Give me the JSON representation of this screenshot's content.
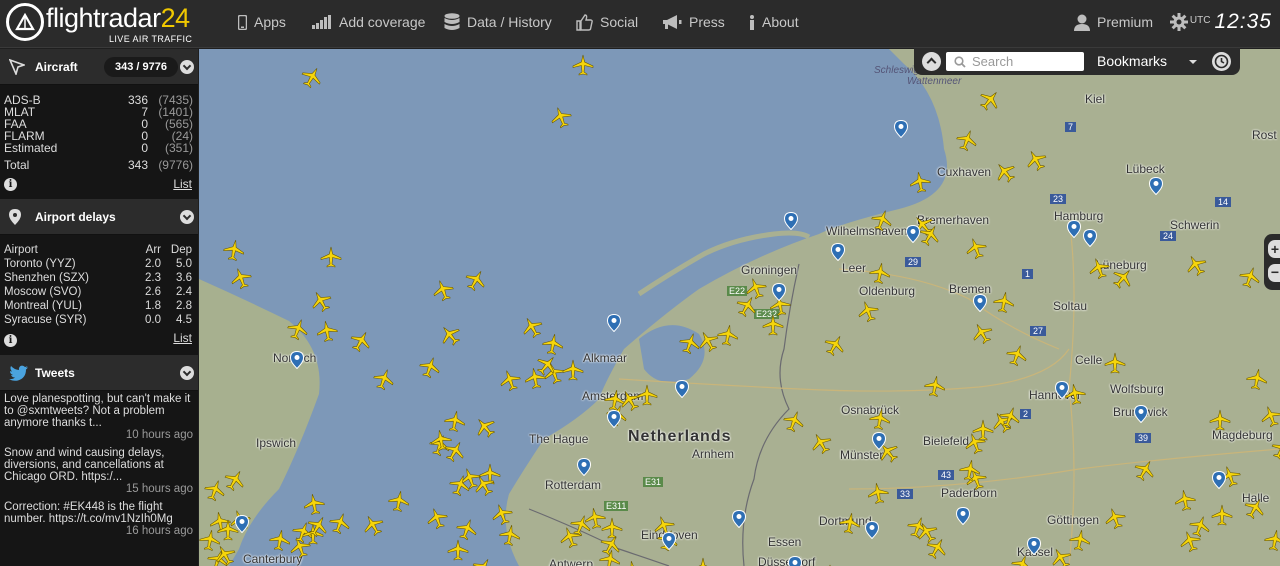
{
  "app": {
    "logo_name": "flightradar",
    "logo_num": "24",
    "logo_tagline": "LIVE AIR TRAFFIC"
  },
  "nav": [
    {
      "label": "Apps",
      "icon": "phone-icon"
    },
    {
      "label": "Add coverage",
      "icon": "signal-bars-icon"
    },
    {
      "label": "Data / History",
      "icon": "database-icon"
    },
    {
      "label": "Social",
      "icon": "thumbs-up-icon"
    },
    {
      "label": "Press",
      "icon": "megaphone-icon"
    },
    {
      "label": "About",
      "icon": "info-icon"
    },
    {
      "label": "Premium",
      "icon": "user-icon"
    }
  ],
  "clock": {
    "zone": "UTC",
    "time": "12:35"
  },
  "search": {
    "placeholder": "Search",
    "bookmarks": "Bookmarks"
  },
  "aircraft": {
    "title": "Aircraft",
    "count": "343 / 9776",
    "rows": [
      {
        "label": "ADS-B",
        "value": "336",
        "total": "(7435)"
      },
      {
        "label": "MLAT",
        "value": "7",
        "total": "(1401)"
      },
      {
        "label": "FAA",
        "value": "0",
        "total": "(565)"
      },
      {
        "label": "FLARM",
        "value": "0",
        "total": "(24)"
      },
      {
        "label": "Estimated",
        "value": "0",
        "total": "(351)"
      }
    ],
    "total": {
      "label": "Total",
      "value": "343",
      "total": "(9776)"
    },
    "list": "List"
  },
  "delays": {
    "title": "Airport delays",
    "headers": {
      "airport": "Airport",
      "arr": "Arr",
      "dep": "Dep"
    },
    "rows": [
      {
        "airport": "Toronto (YYZ)",
        "arr": "2.0",
        "dep": "5.0"
      },
      {
        "airport": "Shenzhen (SZX)",
        "arr": "2.3",
        "dep": "3.6"
      },
      {
        "airport": "Moscow (SVO)",
        "arr": "2.6",
        "dep": "2.4"
      },
      {
        "airport": "Montreal (YUL)",
        "arr": "1.8",
        "dep": "2.8"
      },
      {
        "airport": "Syracuse (SYR)",
        "arr": "0.0",
        "dep": "4.5"
      }
    ],
    "list": "List"
  },
  "tweets": {
    "title": "Tweets",
    "items": [
      {
        "text": "Love planespotting, but can't make it to @sxmtweets? Not a problem anymore thanks t...",
        "when": "10 hours ago"
      },
      {
        "text": "Snow and wind causing delays, diversions, and cancellations at Chicago ORD. https:/...",
        "when": "15 hours ago"
      },
      {
        "text": "Correction: #EK448 is the flight number. https://t.co/mv1NzIh0Mg",
        "when": "16 hours ago"
      }
    ]
  },
  "map_labels": {
    "netherlands": "Netherlands",
    "norwich": "Norwich",
    "ipswich": "Ipswich",
    "canterbury": "Canterbury",
    "alkmaar": "Alkmaar",
    "amsterdam": "Amsterdam",
    "the_hague": "The Hague",
    "rotterdam": "Rotterdam",
    "arnhem": "Arnhem",
    "eindhoven": "Eindhoven",
    "antwerp": "Antwerp",
    "groningen": "Groningen",
    "leer": "Leer",
    "oldenburg": "Oldenburg",
    "wilhelmshaven": "Wilhelmshaven",
    "bremerhaven": "Bremerhaven",
    "cuxhaven": "Cuxhaven",
    "bremen": "Bremen",
    "hamburg": "Hamburg",
    "kiel": "Kiel",
    "lubeck": "Lübeck",
    "schwerin": "Schwerin",
    "luneburg": "Lüneburg",
    "soltau": "Soltau",
    "celle": "Celle",
    "hannover": "Hannover",
    "wolfsburg": "Wolfsburg",
    "brunswick": "Brunswick",
    "magdeburg": "Magdeburg",
    "osnabruck": "Osnabrück",
    "bielefeld": "Bielefeld",
    "munster": "Münster",
    "paderborn": "Paderborn",
    "dortmund": "Dortmund",
    "essen": "Essen",
    "dusseldorf": "Düsseldorf",
    "gottingen": "Göttingen",
    "kassel": "Kassel",
    "halle": "Halle",
    "rostock": "Rost",
    "schleswig": "Schleswig-Holsteinisches",
    "wattenmeer": "Wattenmeer",
    "e22": "E22",
    "e232": "E232",
    "e31": "E31",
    "e311": "E311",
    "r29": "29",
    "r7": "7",
    "r1": "1",
    "r27": "27",
    "r2": "2",
    "r23": "23",
    "r24": "24",
    "r14": "14",
    "r39": "39",
    "r43": "43",
    "r33": "33"
  }
}
